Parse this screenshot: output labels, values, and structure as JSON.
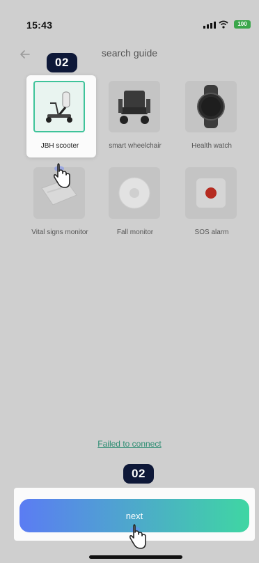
{
  "status_bar": {
    "time": "15:43",
    "battery": "100",
    "icons": [
      "signal-icon",
      "wifi-icon",
      "battery-icon"
    ]
  },
  "header": {
    "title": "search guide",
    "back_icon": "arrow-left-icon"
  },
  "devices": [
    {
      "label": "JBH scooter",
      "icon": "scooter-icon",
      "selected": true
    },
    {
      "label": "smart wheelchair",
      "icon": "wheelchair-icon",
      "selected": false
    },
    {
      "label": "Health watch",
      "icon": "watch-icon",
      "selected": false
    },
    {
      "label": "Vital signs monitor",
      "icon": "vital-monitor-icon",
      "selected": false
    },
    {
      "label": "Fall monitor",
      "icon": "fall-monitor-icon",
      "selected": false
    },
    {
      "label": "SOS alarm",
      "icon": "sos-alarm-icon",
      "selected": false
    }
  ],
  "guide": {
    "step_badge_top": "02",
    "step_badge_bottom": "02",
    "pointer_icon": "hand-pointer-icon"
  },
  "footer": {
    "failed_link": "Failed to connect",
    "next_label": "next"
  },
  "colors": {
    "accent_green": "#3fc39a",
    "gradient_start": "#5b7cf3",
    "gradient_end": "#3fd6a3",
    "badge_bg": "#0e1838",
    "link": "#2d8c72"
  }
}
